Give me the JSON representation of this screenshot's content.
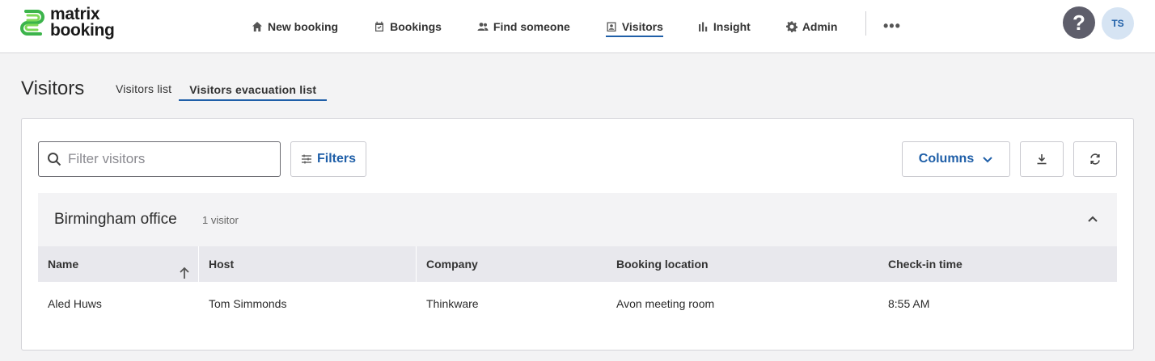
{
  "brand": {
    "line1": "matrix",
    "line2": "booking"
  },
  "nav": {
    "items": [
      {
        "label": "New booking",
        "icon": "home-icon"
      },
      {
        "label": "Bookings",
        "icon": "calendar-check-icon"
      },
      {
        "label": "Find someone",
        "icon": "people-icon"
      },
      {
        "label": "Visitors",
        "icon": "badge-icon",
        "active": true
      },
      {
        "label": "Insight",
        "icon": "bar-chart-icon"
      },
      {
        "label": "Admin",
        "icon": "gear-icon"
      }
    ],
    "more": "•••"
  },
  "user": {
    "help": "?",
    "initials": "TS"
  },
  "page": {
    "title": "Visitors",
    "tabs": [
      {
        "label": "Visitors list",
        "active": false
      },
      {
        "label": "Visitors evacuation list",
        "active": true
      }
    ]
  },
  "toolbar": {
    "search_placeholder": "Filter visitors",
    "filters_label": "Filters",
    "columns_label": "Columns"
  },
  "group": {
    "title": "Birmingham office",
    "count": "1 visitor"
  },
  "table": {
    "columns": [
      "Name",
      "Host",
      "Company",
      "Booking location",
      "Check-in time"
    ],
    "rows": [
      {
        "name": "Aled Huws",
        "host": "Tom Simmonds",
        "company": "Thinkware",
        "location": "Avon meeting room",
        "checkin": "8:55 AM"
      }
    ]
  },
  "colors": {
    "accent": "#1f5fa8",
    "logo_green": "#3cb44b",
    "help_bg": "#5e5e6b",
    "avatar_bg": "#d6e4f3"
  }
}
